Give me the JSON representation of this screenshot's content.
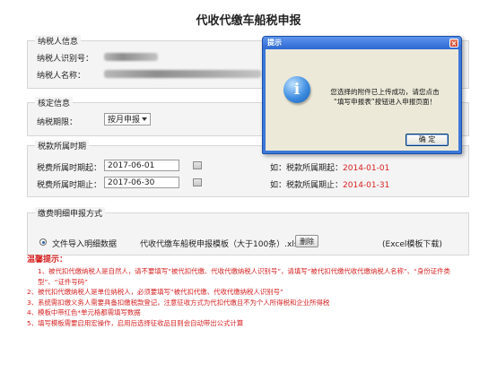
{
  "page": {
    "title": "代收代缴车船税申报"
  },
  "taxpayer": {
    "legend": "纳税人信息",
    "id_label": "纳税人识别号：",
    "name_label": "纳税人名称："
  },
  "verify": {
    "legend": "核定信息",
    "period_label": "纳税期限：",
    "period_value": "按月申报"
  },
  "period": {
    "legend": "税款所属时期",
    "start_label": "税费所属时期起：",
    "start_value": "2017-06-01",
    "end_label": "税费所属时期止：",
    "end_value": "2017-06-30",
    "example_start_prefix": "如：税款所属期起：",
    "example_start_date": "2014-01-01",
    "example_end_prefix": "如：税款所属期止：",
    "example_end_date": "2014-01-31"
  },
  "detail": {
    "legend": "缴费明细申报方式",
    "option_label": "文件导入明细数据",
    "file_name": "代收代缴车船税申报模板（大于100条）.xls",
    "delete_label": "删除",
    "template_link": "(Excel模板下载)"
  },
  "tips": {
    "title": "温馨提示：",
    "items": [
      "1、被代扣代缴纳税人是自然人，请不要填写“被代扣代缴、代收代缴纳税人识别号”，请填写“被代扣代缴代收代缴纳税人名称”、“身份证件类型”、“证件号码”",
      "2、被代扣代缴纳税人是单位纳税人，必须要填写“被代扣代缴、代收代缴纳税人识别号”",
      "3、系统需扣缴义务人需要具备扣缴税款登记，注意征收方式为代扣代缴且不为个人所得税和企业所得税",
      "4、模板中带红色*单元格都需填写数据",
      "5、填写模板需要启用宏操作，启用后选择征收品目则会自动带出公式计算"
    ]
  },
  "dialog": {
    "title": "提示",
    "message_line1": "您选择的附件已上传成功，请您点击",
    "message_line2": "“填写申报表”按钮进入申报页面！",
    "ok_label": "确 定"
  },
  "colors": {
    "accent": "#d62222",
    "dialog_blue": "#3c78d8"
  }
}
